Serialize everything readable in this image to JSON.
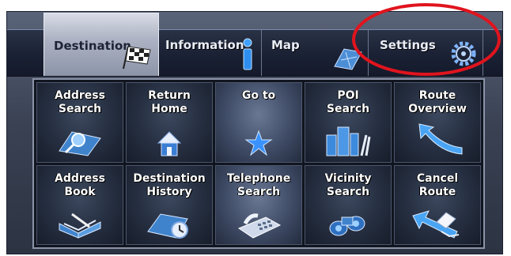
{
  "tabs": [
    {
      "label": "Destination"
    },
    {
      "label": "Information"
    },
    {
      "label": "Map"
    },
    {
      "label": "Settings"
    }
  ],
  "buttons": [
    {
      "label": "Address\nSearch",
      "icon": "map-magnifier-icon"
    },
    {
      "label": "Return\nHome",
      "icon": "house-icon"
    },
    {
      "label": "Go to",
      "icon": "star-icon"
    },
    {
      "label": "POI\nSearch",
      "icon": "buildings-icon"
    },
    {
      "label": "Route\nOverview",
      "icon": "curved-arrow-icon"
    },
    {
      "label": "Address\nBook",
      "icon": "open-book-icon"
    },
    {
      "label": "Destination\nHistory",
      "icon": "map-clock-icon"
    },
    {
      "label": "Telephone\nSearch",
      "icon": "telephone-icon"
    },
    {
      "label": "Vicinity\nSearch",
      "icon": "binoculars-icon"
    },
    {
      "label": "Cancel\nRoute",
      "icon": "eraser-icon"
    }
  ],
  "colors": {
    "annotation_circle": "#e0141e",
    "selected_tab": "#c4c9d6"
  }
}
